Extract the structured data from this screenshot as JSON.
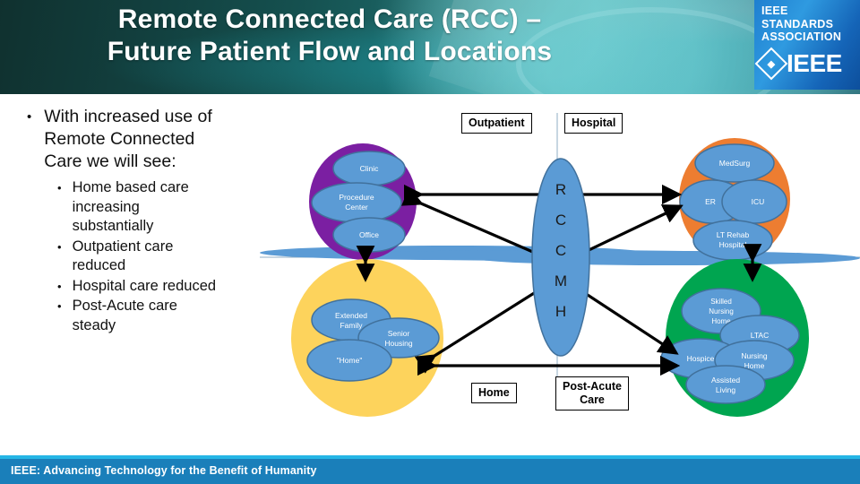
{
  "title": {
    "line1": "Remote Connected Care (RCC) –",
    "line2": "Future Patient Flow and Locations"
  },
  "logo": {
    "sa_line1": "IEEE",
    "sa_line2": "STANDARDS",
    "sa_line3": "ASSOCIATION",
    "mark_glyph": "⬧",
    "wordmark": "IEEE"
  },
  "bullets": {
    "marker": "•",
    "level1": "With increased use of Remote Connected Care we will see:",
    "level1_lines": [
      "With increased use of",
      "Remote Connected",
      "Care we will see:"
    ],
    "level2": [
      {
        "text": "Home based care increasing substantially",
        "lines": [
          "Home based care",
          "increasing",
          "substantially"
        ]
      },
      {
        "text": "Outpatient care reduced",
        "lines": [
          "Outpatient care",
          "reduced"
        ]
      },
      {
        "text": "Hospital care reduced",
        "lines": [
          "Hospital care reduced"
        ]
      },
      {
        "text": "Post-Acute care steady",
        "lines": [
          "Post-Acute care",
          "steady"
        ]
      }
    ]
  },
  "diagram": {
    "center_node": {
      "label": "RCCMH",
      "letters": [
        "R",
        "C",
        "C",
        "M",
        "H"
      ],
      "color": "#5b9bd5"
    },
    "quadrant_labels": [
      {
        "id": "outpatient",
        "text": "Outpatient"
      },
      {
        "id": "hospital",
        "text": "Hospital"
      },
      {
        "id": "home",
        "text": "Home"
      },
      {
        "id": "post-acute",
        "text": "Post-Acute Care",
        "lines": [
          "Post-Acute",
          "Care"
        ]
      }
    ],
    "clusters": [
      {
        "id": "outpatient",
        "name": "Outpatient",
        "color": "#7b1fa2",
        "nodes": [
          {
            "label": "Clinic",
            "lines": [
              "Clinic"
            ]
          },
          {
            "label": "Procedure Center",
            "lines": [
              "Procedure",
              "Center"
            ]
          },
          {
            "label": "Office",
            "lines": [
              "Office"
            ]
          }
        ]
      },
      {
        "id": "hospital",
        "name": "Hospital",
        "color": "#ed7d31",
        "nodes": [
          {
            "label": "MedSurg",
            "lines": [
              "MedSurg"
            ]
          },
          {
            "label": "ER",
            "lines": [
              "ER"
            ]
          },
          {
            "label": "ICU",
            "lines": [
              "ICU"
            ]
          },
          {
            "label": "LT Rehab Hospital",
            "lines": [
              "LT Rehab",
              "Hospital"
            ]
          }
        ]
      },
      {
        "id": "home",
        "name": "Home",
        "color": "#fdd35c",
        "nodes": [
          {
            "label": "Extended Family",
            "lines": [
              "Extended",
              "Family"
            ]
          },
          {
            "label": "Senior Housing",
            "lines": [
              "Senior",
              "Housing"
            ]
          },
          {
            "label": "\"Home\"",
            "lines": [
              "\"Home\""
            ]
          }
        ]
      },
      {
        "id": "post-acute",
        "name": "Post-Acute Care",
        "color": "#00a550",
        "nodes": [
          {
            "label": "Skilled Nursing Home",
            "lines": [
              "Skilled",
              "Nursing",
              "Home"
            ]
          },
          {
            "label": "LTAC",
            "lines": [
              "LTAC"
            ]
          },
          {
            "label": "Hospice",
            "lines": [
              "Hospice"
            ]
          },
          {
            "label": "Nursing Home",
            "lines": [
              "Nursing",
              "Home"
            ]
          },
          {
            "label": "Assisted Living",
            "lines": [
              "Assisted",
              "Living"
            ]
          }
        ]
      }
    ],
    "node_fill": "#5b9bd5",
    "node_stroke": "#41719c",
    "axis_color": "#8faec4",
    "arrow_color": "#000000"
  },
  "footer": {
    "text": "IEEE: Advancing Technology for the Benefit of Humanity",
    "stripe_color": "#25b6e6",
    "bar_color": "#1a7fba"
  }
}
